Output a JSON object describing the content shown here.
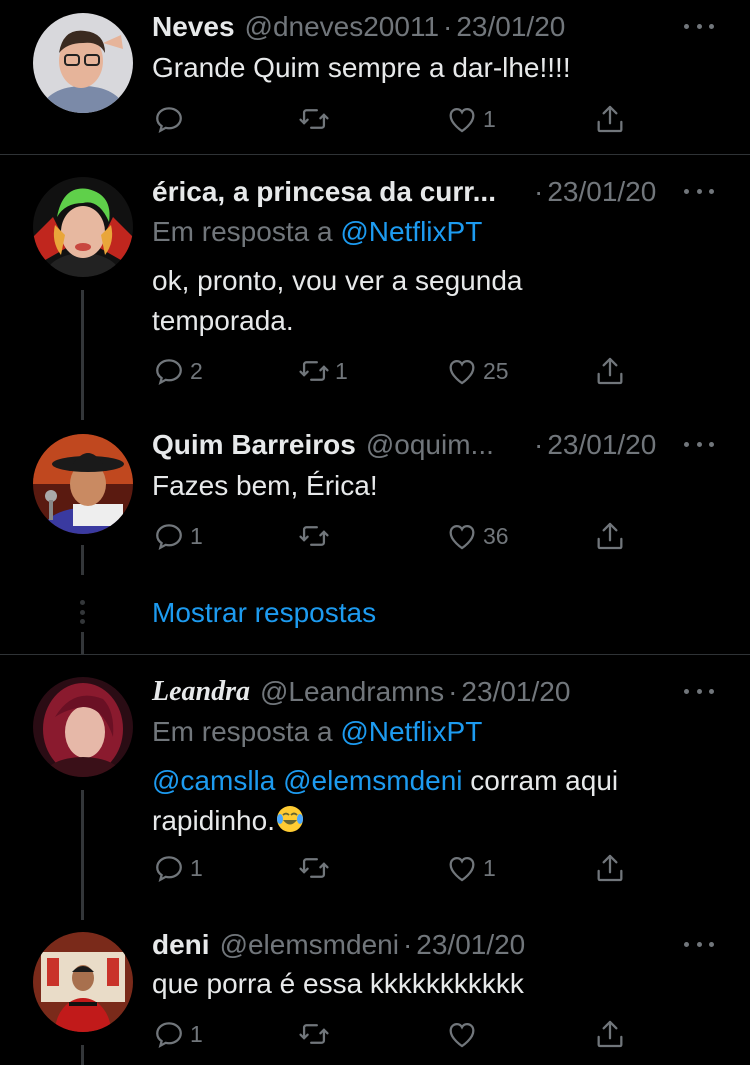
{
  "tweets": [
    {
      "name": "Neves",
      "handle": "@dneves20011",
      "dot": "·",
      "date": "23/01/20",
      "text": "Grande Quim sempre a dar-lhe!!!!",
      "replies": "",
      "retweets": "",
      "likes": "1"
    },
    {
      "name": "érica, a princesa da curr...",
      "handle": "",
      "dot": "·",
      "date": "23/01/20",
      "reply_prefix": "Em resposta a",
      "reply_to": "@NetflixPT",
      "text": "ok, pronto, vou ver a segunda temporada.",
      "replies": "2",
      "retweets": "1",
      "likes": "25"
    },
    {
      "name": "Quim Barreiros",
      "handle": "@oquim...",
      "dot": "·",
      "date": "23/01/20",
      "text": "Fazes bem, Érica!",
      "replies": "1",
      "retweets": "",
      "likes": "36"
    },
    {
      "name": "Leandra",
      "handle": "@Leandramns",
      "dot": "·",
      "date": "23/01/20",
      "reply_prefix": "Em resposta a",
      "reply_to": "@NetflixPT",
      "mention1": "@camslla",
      "mention2": "@elemsmdeni",
      "text_after": "corram aqui rapidinho.",
      "emoji": "face-with-tears-of-joy",
      "replies": "1",
      "retweets": "",
      "likes": "1"
    },
    {
      "name": "deni",
      "handle": "@elemsmdeni",
      "dot": "·",
      "date": "23/01/20",
      "text": "que porra é essa kkkkkkkkkkk",
      "replies": "1",
      "retweets": "",
      "likes": ""
    }
  ],
  "show_replies": "Mostrar respostas",
  "colors": {
    "background": "#000000",
    "accent": "#1d9bf0",
    "muted": "#71767b",
    "text": "#e7e9ea"
  }
}
